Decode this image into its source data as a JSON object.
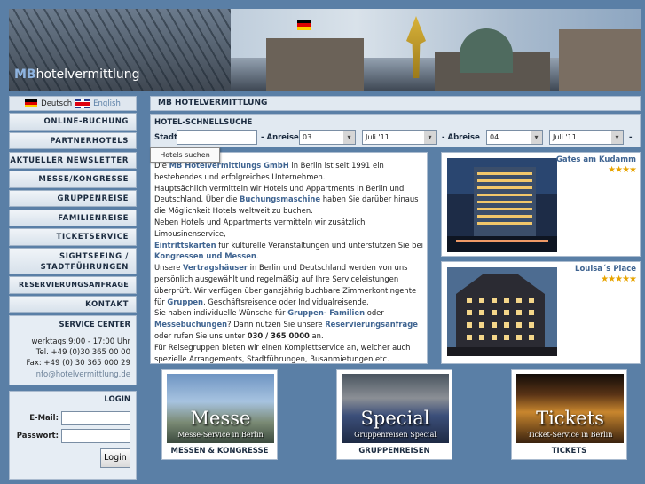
{
  "logo": {
    "mb": "MB",
    "rest": "hotelvermittlung"
  },
  "lang": {
    "de": "Deutsch",
    "en": "English"
  },
  "nav": [
    "ONLINE-BUCHUNG",
    "PARTNERHOTELS",
    "AKTUELLER NEWSLETTER",
    "MESSE/KONGRESSE",
    "GRUPPENREISE",
    "FAMILIENREISE",
    "TICKETSERVICE",
    "SIGHTSEEING /",
    "STADTFÜHRUNGEN",
    "RESERVIERUNGSANFRAGE",
    "KONTAKT"
  ],
  "service": {
    "title": "SERVICE CENTER",
    "hours": "werktags 9:00 - 17:00 Uhr",
    "tel": "Tel. +49 (0)30 365 00 00",
    "fax": "Fax: +49 (0) 30 365 000 29",
    "email": "info@hotelvermittlung.de"
  },
  "login": {
    "title": "LOGIN",
    "email_label": "E-Mail:",
    "password_label": "Passwort:",
    "button": "Login"
  },
  "main_title": "MB HOTELVERMITTLUNG",
  "search": {
    "title": "HOTEL-SCHNELLSUCHE",
    "stadt": "Stadt",
    "anreise": "- Anreise",
    "anreise_day": "03",
    "anreise_month": "Juli '11",
    "abreise": "- Abreise",
    "abreise_day": "04",
    "abreise_month": "Juli '11",
    "dash": "-",
    "button": "Hotels suchen"
  },
  "intro": {
    "p1a": "Die ",
    "p1b": "MB Hotelvermittlungs GmbH",
    "p1c": " in Berlin ist seit 1991 ein bestehendes und erfolgreiches Unternehmen.",
    "p2a": "Hauptsächlich vermitteln wir Hotels und Appartments in Berlin und Deutschland. Über die ",
    "p2b": "Buchungsmaschine",
    "p2c": " haben Sie darüber hinaus die Möglichkeit Hotels weltweit zu buchen.",
    "p3": "Neben Hotels und Appartments vermitteln wir zusätzlich Limousinenservice,",
    "p4a": "Eintrittskarten",
    "p4b": " für kulturelle Veranstaltungen und unterstützen Sie bei ",
    "p4c": "Kongressen und Messen",
    "p4d": ".",
    "p5a": "Unsere ",
    "p5b": "Vertragshäuser",
    "p5c": " in Berlin und Deutschland werden von uns persönlich ausgewählt und regelmäßig auf Ihre Serviceleistungen überprüft. Wir verfügen über ganzjährig buchbare Zimmerkontingente für ",
    "p5d": "Gruppen",
    "p5e": ", Geschäftsreisende oder Individualreisende.",
    "p6a": "Sie haben individuelle Wünsche für ",
    "p6b": "Gruppen- Familien",
    "p6c": " oder ",
    "p6d": "Messebuchungen",
    "p6e": "? Dann nutzen Sie unsere ",
    "p6f": "Reservierungsanfrage",
    "p6g": " oder rufen Sie uns unter ",
    "p6h": "030 / 365 0000",
    "p6i": " an.",
    "p7": "Für Reisegruppen bieten wir einen Komplettservice an, welcher auch spezielle Arrangements, Stadtführungen, Busanmietungen etc. umfassen kann."
  },
  "hotels": [
    {
      "name": "Gates am Kudamm",
      "stars": "★★★★"
    },
    {
      "name": "Louisa´s Place",
      "stars": "★★★★★"
    }
  ],
  "promos": [
    {
      "big": "Messe",
      "small": "Messe-Service in Berlin",
      "caption": "MESSEN & KONGRESSE"
    },
    {
      "big": "Special",
      "small": "Gruppenreisen Special",
      "caption": "GRUPPENREISEN"
    },
    {
      "big": "Tickets",
      "small": "Ticket-Service in Berlin",
      "caption": "TICKETS"
    }
  ],
  "colors": {
    "bg": "#5a7fa6",
    "accent": "#3f6491",
    "star": "#e8a400"
  }
}
